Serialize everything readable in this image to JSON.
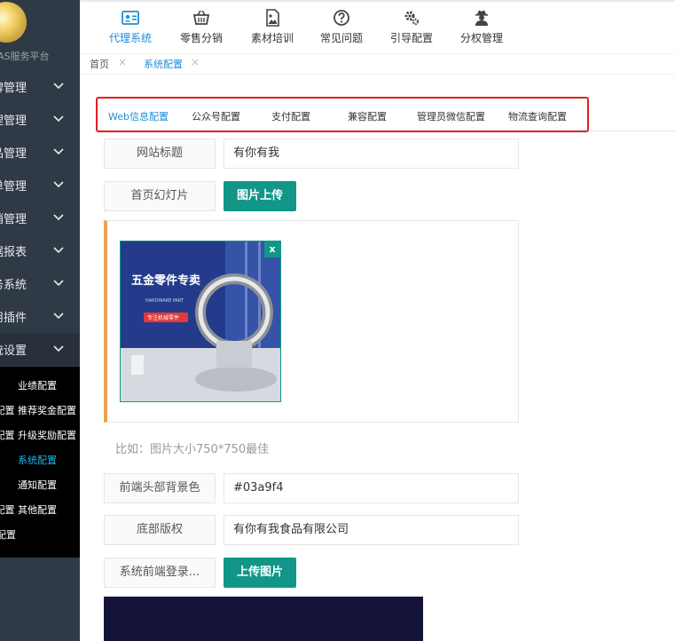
{
  "sidebar": {
    "platform_name": "AS服务平台",
    "items": [
      {
        "label": "牌管理"
      },
      {
        "label": "理管理"
      },
      {
        "label": "品管理"
      },
      {
        "label": "单管理"
      },
      {
        "label": "销管理"
      },
      {
        "label": "据报表"
      },
      {
        "label": "务系统"
      },
      {
        "label": "用插件"
      },
      {
        "label": "统设置"
      }
    ],
    "submenu": [
      {
        "label": "业绩配置"
      },
      {
        "label": "配置 推荐奖金配置"
      },
      {
        "label": "配置 升级奖励配置"
      },
      {
        "label": "系统配置"
      },
      {
        "label": "通知配置"
      },
      {
        "label": "配置 其他配置"
      },
      {
        "label": "配置"
      }
    ]
  },
  "topbar": {
    "tabs": [
      {
        "label": "代理系统",
        "icon": "id-card-icon"
      },
      {
        "label": "零售分销",
        "icon": "basket-icon"
      },
      {
        "label": "素材培训",
        "icon": "image-file-icon"
      },
      {
        "label": "常见问题",
        "icon": "question-circle-icon"
      },
      {
        "label": "引导配置",
        "icon": "gears-icon"
      },
      {
        "label": "分权管理",
        "icon": "user-secret-icon"
      }
    ]
  },
  "breadcrumb": {
    "home": "首页",
    "current": "系统配置",
    "close_glyph": "×"
  },
  "subtabs": [
    {
      "label": "Web信息配置"
    },
    {
      "label": "公众号配置"
    },
    {
      "label": "支付配置"
    },
    {
      "label": "兼容配置"
    },
    {
      "label": "管理员微信配置"
    },
    {
      "label": "物流查询配置"
    }
  ],
  "form": {
    "site_title_label": "网站标题",
    "site_title_value": "有你有我",
    "slideshow_label": "首页幻灯片",
    "upload_button": "图片上传",
    "banner": {
      "close_glyph": "x",
      "headline": "五金零件专卖",
      "sub_line": "HARDWARE PART",
      "badge": "专注机械零件"
    },
    "hint": "比如：图片大小750*750最佳",
    "header_bg_label": "前端头部背景色",
    "header_bg_value": "#03a9f4",
    "footer_label": "底部版权",
    "footer_value": "有你有我食品有限公司",
    "login_label": "系统前端登录...",
    "login_upload_button": "上传图片"
  },
  "colors": {
    "sidebar_bg": "#2f3a46",
    "accent_teal": "#119688",
    "active_blue": "#1e8ed6",
    "highlight_red": "#e02020"
  }
}
